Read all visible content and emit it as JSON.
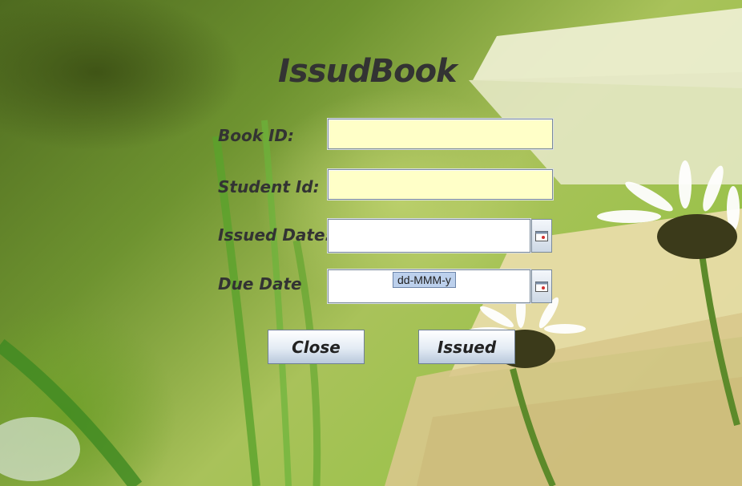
{
  "title": "IssudBook",
  "form": {
    "book_id_label": "Book ID:",
    "student_id_label": "Student Id:",
    "issued_date_label": "Issued Date:",
    "due_date_label": "Due Date",
    "book_id_value": "",
    "student_id_value": "",
    "issued_date_value": "",
    "due_date_value": "",
    "date_format_hint": "dd-MMM-y"
  },
  "buttons": {
    "close_label": "Close",
    "issued_label": "Issued"
  },
  "icons": {
    "calendar": "calendar-icon"
  },
  "colors": {
    "text_field_bg": "#ffffc8",
    "label_text": "#333333"
  }
}
